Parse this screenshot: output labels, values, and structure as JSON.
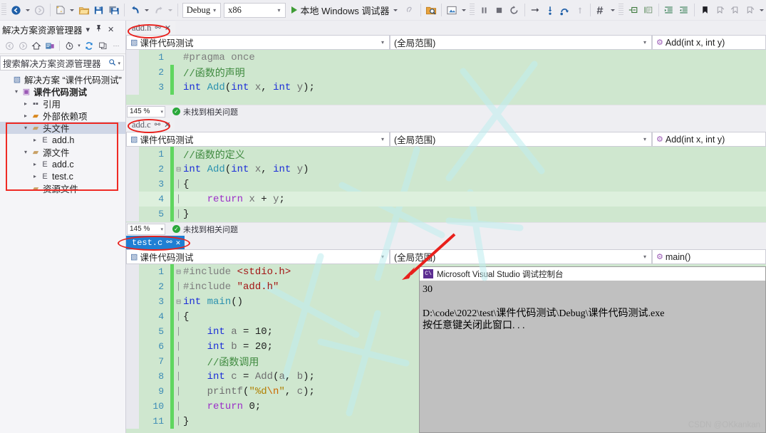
{
  "toolbar": {
    "icons": [
      {
        "name": "navigate-backward-icon",
        "glyph": "◉"
      },
      {
        "name": "navigate-forward-icon",
        "glyph": "○"
      },
      {
        "name": "new-item-icon",
        "glyph": "❐"
      },
      {
        "name": "open-file-icon",
        "glyph": "὜1"
      },
      {
        "name": "save-icon",
        "glyph": "ὋE"
      },
      {
        "name": "save-all-icon",
        "glyph": "὚B"
      },
      {
        "name": "undo-icon",
        "glyph": "↶"
      },
      {
        "name": "redo-icon",
        "glyph": "↷"
      }
    ],
    "config_value": "Debug",
    "platform_value": "x86",
    "run_label": "本地 Windows 调试器",
    "right_icons": [
      {
        "name": "attach-process-icon",
        "glyph": "⚯"
      },
      {
        "name": "find-in-files-icon",
        "glyph": "ὐD"
      },
      {
        "name": "screenshot-icon",
        "glyph": "▣"
      },
      {
        "name": "pause-icon",
        "glyph": "‖"
      },
      {
        "name": "stop-icon",
        "glyph": "■"
      },
      {
        "name": "restart-icon",
        "glyph": "↺"
      },
      {
        "name": "show-next-statement-icon",
        "glyph": "→"
      },
      {
        "name": "step-into-icon",
        "glyph": "↓"
      },
      {
        "name": "step-over-icon",
        "glyph": "⤴"
      },
      {
        "name": "step-out-icon",
        "glyph": "↑"
      },
      {
        "name": "hex-display-icon",
        "glyph": "♯"
      },
      {
        "name": "toggle-outlining-icon",
        "glyph": "▤"
      },
      {
        "name": "comment-icon",
        "glyph": "▥"
      },
      {
        "name": "indent-icon",
        "glyph": "≡"
      },
      {
        "name": "outdent-icon",
        "glyph": "≣"
      },
      {
        "name": "bookmark-icon",
        "glyph": "▮"
      },
      {
        "name": "next-bookmark-icon",
        "glyph": "↱"
      },
      {
        "name": "previous-bookmark-icon",
        "glyph": "↰"
      },
      {
        "name": "clear-bookmarks-icon",
        "glyph": "↴"
      }
    ]
  },
  "solution_explorer": {
    "title": "解决方案资源管理器",
    "dropdown_glyph": "▾",
    "pin_glyph": "ὌC",
    "close_glyph": "✕",
    "tools": [
      {
        "name": "back-icon",
        "glyph": "◁"
      },
      {
        "name": "forward-icon",
        "glyph": "▷"
      },
      {
        "name": "home-icon",
        "glyph": "⌂"
      },
      {
        "name": "pending-changes-icon",
        "glyph": "⌸"
      },
      {
        "name": "show-all-files-icon",
        "glyph": "◔"
      },
      {
        "name": "refresh-icon",
        "glyph": "↻"
      },
      {
        "name": "collapse-all-icon",
        "glyph": "❐"
      },
      {
        "name": "properties-icon",
        "glyph": "…"
      }
    ],
    "search_placeholder": "搜索解决方案资源管理器",
    "search_icon": "ὐE",
    "search_caret": "▾",
    "tree": [
      {
        "indent": 0,
        "tw": "",
        "icon": "▧",
        "icon_color": "#4a6fa5",
        "label": "解决方案 “课件代码测试”",
        "bold": false,
        "selected": false
      },
      {
        "indent": 1,
        "tw": "▾",
        "icon": "▣",
        "icon_color": "#9b59b6",
        "label": "课件代码测试",
        "bold": true,
        "selected": false
      },
      {
        "indent": 2,
        "tw": "▸",
        "icon": "▪▪",
        "icon_color": "#55555f",
        "label": "引用",
        "bold": false,
        "selected": false
      },
      {
        "indent": 2,
        "tw": "▸",
        "icon": "▰",
        "icon_color": "#d9881f",
        "label": "外部依赖项",
        "bold": false,
        "selected": false
      },
      {
        "indent": 2,
        "tw": "▾",
        "icon": "▰",
        "icon_color": "#c8a165",
        "label": "头文件",
        "bold": false,
        "selected": true
      },
      {
        "indent": 3,
        "tw": "▸",
        "icon": "὜E",
        "icon_color": "#55555f",
        "label": "add.h",
        "bold": false,
        "selected": false
      },
      {
        "indent": 2,
        "tw": "▾",
        "icon": "▰",
        "icon_color": "#c8a165",
        "label": "源文件",
        "bold": false,
        "selected": false
      },
      {
        "indent": 3,
        "tw": "▸",
        "icon": "὜E",
        "icon_color": "#55555f",
        "label": "add.c",
        "bold": false,
        "selected": false
      },
      {
        "indent": 3,
        "tw": "▸",
        "icon": "὜E",
        "icon_color": "#55555f",
        "label": "test.c",
        "bold": false,
        "selected": false
      },
      {
        "indent": 2,
        "tw": "",
        "icon": "▰",
        "icon_color": "#c8a165",
        "label": "资源文件",
        "bold": false,
        "selected": false
      }
    ]
  },
  "panes": [
    {
      "tab_label": "add.h",
      "tab_pin": "⚯",
      "tab_close": "✕",
      "active": false,
      "scope_left": "课件代码测试",
      "scope_left_icon": "▧",
      "scope_mid": "(全局范围)",
      "scope_right": "Add(int x, int y)",
      "scope_right_icon": "⚙",
      "zoom": "145 %",
      "status_text": "未找到相关问题",
      "status_icon": "✓",
      "lines": [
        {
          "n": "1",
          "chg": false,
          "fold": "",
          "html": "<span class=\"pp\">#pragma once</span>"
        },
        {
          "n": "2",
          "chg": true,
          "fold": "",
          "html": "<span class=\"cm\">//函数的声明</span>"
        },
        {
          "n": "3",
          "chg": true,
          "fold": "",
          "html": "<span class=\"k\">int</span> <span class=\"ty\">Add</span>(<span class=\"k\">int</span> <span class=\"vr\">x</span>, <span class=\"k\">int</span> <span class=\"vr\">y</span>);"
        }
      ]
    },
    {
      "tab_label": "add.c",
      "tab_pin": "⚯",
      "tab_close": "✕",
      "active": false,
      "scope_left": "课件代码测试",
      "scope_left_icon": "▧",
      "scope_mid": "(全局范围)",
      "scope_right": "Add(int x, int y)",
      "scope_right_icon": "⚙",
      "zoom": "145 %",
      "status_text": "未找到相关问题",
      "status_icon": "✓",
      "lines": [
        {
          "n": "1",
          "chg": true,
          "fold": "",
          "html": "<span class=\"cm\">//函数的定义</span>"
        },
        {
          "n": "2",
          "chg": true,
          "fold": "⊟",
          "html": "<span class=\"k\">int</span> <span class=\"ty\">Add</span>(<span class=\"k\">int</span> <span class=\"vr\">x</span>, <span class=\"k\">int</span> <span class=\"vr\">y</span>)"
        },
        {
          "n": "3",
          "chg": true,
          "fold": "│",
          "html": "{"
        },
        {
          "n": "4",
          "chg": true,
          "fold": "│",
          "html": "    <span class=\"kp\">return</span> <span class=\"vr\">x</span> + <span class=\"vr\">y</span>;",
          "hl": true
        },
        {
          "n": "5",
          "chg": true,
          "fold": "│",
          "html": "}"
        }
      ]
    },
    {
      "tab_label": "test.c",
      "tab_pin": "⚯",
      "tab_close": "✕",
      "active": true,
      "scope_left": "课件代码测试",
      "scope_left_icon": "▧",
      "scope_mid": "(全局范围)",
      "scope_right": "main()",
      "scope_right_icon": "⚙",
      "lines": [
        {
          "n": "1",
          "chg": true,
          "fold": "⊟",
          "html": "<span class=\"pp\">#include</span> <span class=\"str\">&lt;stdio.h&gt;</span>"
        },
        {
          "n": "2",
          "chg": true,
          "fold": "│",
          "html": "<span class=\"pp\">#include</span> <span class=\"str\">\"add.h\"</span>"
        },
        {
          "n": "3",
          "chg": true,
          "fold": "⊟",
          "html": "<span class=\"k\">int</span> <span class=\"ty\">main</span>()"
        },
        {
          "n": "4",
          "chg": true,
          "fold": "│",
          "html": "{"
        },
        {
          "n": "5",
          "chg": true,
          "fold": "│",
          "html": "    <span class=\"k\">int</span> <span class=\"vr\">a</span> = <span class=\"num\">10</span>;"
        },
        {
          "n": "6",
          "chg": true,
          "fold": "│",
          "html": "    <span class=\"k\">int</span> <span class=\"vr\">b</span> = <span class=\"num\">20</span>;"
        },
        {
          "n": "7",
          "chg": true,
          "fold": "│",
          "html": "    <span class=\"cm\">//函数调用</span>"
        },
        {
          "n": "8",
          "chg": true,
          "fold": "│",
          "html": "    <span class=\"k\">int</span> <span class=\"vr\">c</span> = <span class=\"fn\">Add</span>(<span class=\"vr\">a</span>, <span class=\"vr\">b</span>);"
        },
        {
          "n": "9",
          "chg": true,
          "fold": "│",
          "html": "    <span class=\"fn\">printf</span>(<span class=\"strq\">\"%d</span><span class=\"esc\">\\n</span><span class=\"strq\">\"</span>, <span class=\"vr\">c</span>);"
        },
        {
          "n": "10",
          "chg": true,
          "fold": "│",
          "html": "    <span class=\"kp\">return</span> <span class=\"num\">0</span>;"
        },
        {
          "n": "11",
          "chg": true,
          "fold": "│",
          "html": "}"
        }
      ]
    }
  ],
  "console": {
    "icon_text": "C\\",
    "title": "Microsoft Visual Studio 调试控制台",
    "output": "30\n\nD:\\code\\2022\\test\\课件代码测试\\Debug\\课件代码测试.exe\n按任意键关闭此窗口. . ."
  },
  "watermark": "CSDN @OKkankan",
  "colors": {
    "accent": "#1f7fd4",
    "editor_bg": "#cfe7cf",
    "change_bar": "#5fd65f",
    "annotation_red": "#e8201c",
    "console_bg": "#c0c0c0"
  }
}
